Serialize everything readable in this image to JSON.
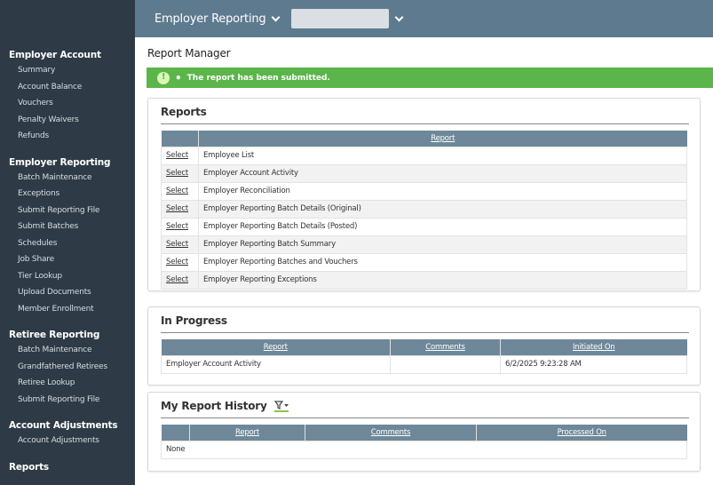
{
  "topbar": {
    "module_label": "Employer Reporting",
    "employer_select_value": ""
  },
  "sidebar": {
    "groups": [
      {
        "heading": "Employer Account",
        "items": [
          "Summary",
          "Account Balance",
          "Vouchers",
          "Penalty Waivers",
          "Refunds"
        ]
      },
      {
        "heading": "Employer Reporting",
        "items": [
          "Batch Maintenance",
          "Exceptions",
          "Submit Reporting File",
          "Submit Batches",
          "Schedules",
          "Job Share",
          "Tier Lookup",
          "Upload Documents",
          "Member Enrollment"
        ]
      },
      {
        "heading": "Retiree Reporting",
        "items": [
          "Batch Maintenance",
          "Grandfathered Retirees",
          "Retiree Lookup",
          "Submit Reporting File"
        ]
      },
      {
        "heading": "Account Adjustments",
        "items": [
          "Account Adjustments"
        ]
      },
      {
        "heading": "Reports",
        "items": []
      }
    ]
  },
  "main": {
    "page_title": "Report Manager",
    "alert": {
      "message": "The report has been submitted.",
      "bullet": "•",
      "color": "#5cb54a"
    },
    "reports": {
      "title": "Reports",
      "header": "Report",
      "select_label": "Select",
      "rows": [
        "Employee List",
        "Employer Account Activity",
        "Employer Reconciliation",
        "Employer Reporting Batch Details (Original)",
        "Employer Reporting Batch Details (Posted)",
        "Employer Reporting Batch Summary",
        "Employer Reporting Batches and Vouchers",
        "Employer Reporting Exceptions"
      ]
    },
    "in_progress": {
      "title": "In Progress",
      "columns": [
        "Report",
        "Comments",
        "Initiated On"
      ],
      "rows": [
        {
          "report": "Employer Account Activity",
          "comments": "",
          "initiated_on": "6/2/2025 9:23:28 AM"
        }
      ]
    },
    "history": {
      "title": "My Report History",
      "columns": [
        "Report",
        "Comments",
        "Processed On"
      ],
      "empty_text": "None"
    }
  }
}
